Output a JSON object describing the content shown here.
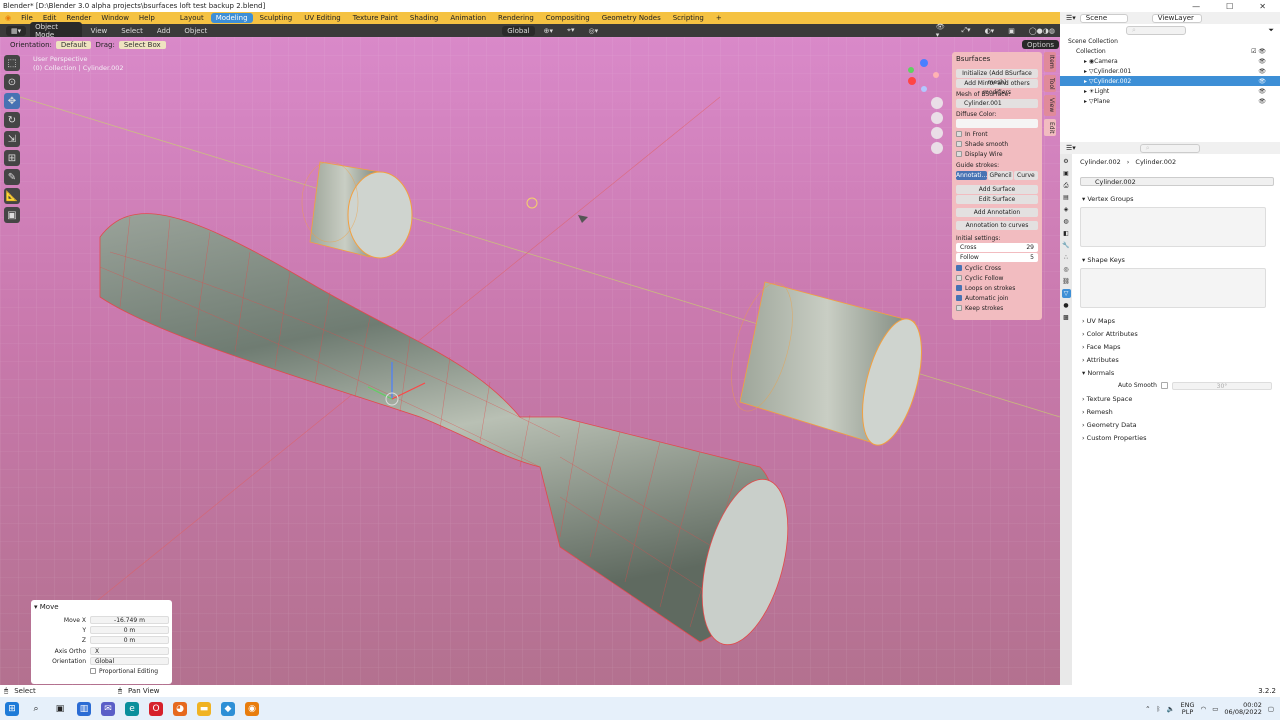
{
  "window": {
    "title": "Blender* [D:\\Blender 3.0 alpha projects\\bsurfaces loft test backup 2.blend]",
    "controls": [
      "—",
      "☐",
      "✕"
    ]
  },
  "menus": [
    "File",
    "Edit",
    "Render",
    "Window",
    "Help"
  ],
  "workspaces": [
    {
      "label": "Layout",
      "active": false
    },
    {
      "label": "Modeling",
      "active": true
    },
    {
      "label": "Sculpting",
      "active": false
    },
    {
      "label": "UV Editing",
      "active": false
    },
    {
      "label": "Texture Paint",
      "active": false
    },
    {
      "label": "Shading",
      "active": false
    },
    {
      "label": "Animation",
      "active": false
    },
    {
      "label": "Rendering",
      "active": false
    },
    {
      "label": "Compositing",
      "active": false
    },
    {
      "label": "Geometry Nodes",
      "active": false
    },
    {
      "label": "Scripting",
      "active": false
    }
  ],
  "scene": {
    "scene_name": "Scene",
    "view_layer": "ViewLayer"
  },
  "viewport_header": {
    "mode": "Object Mode",
    "menus": [
      "View",
      "Select",
      "Add",
      "Object"
    ],
    "transform_orientation": "Global",
    "options_label": "Options"
  },
  "tool_settings": {
    "orientation_label": "Orientation:",
    "orientation_value": "Default",
    "drag_label": "Drag:",
    "drag_value": "Select Box"
  },
  "viewport_overlay": {
    "line1": "User Perspective",
    "line2": "(0) Collection | Cylinder.002"
  },
  "npanel": {
    "title": "Bsurfaces",
    "init_button": "Initialize (Add BSurface mesh)",
    "mirror_button": "Add Mirror and others modifiers",
    "mesh_label": "Mesh of BSurface:",
    "mesh_value": "Cylinder.001",
    "diffuse_label": "Diffuse Color:",
    "in_front": "In Front",
    "shade_smooth": "Shade smooth",
    "display_wire": "Display Wire",
    "guide_label": "Guide strokes:",
    "guide_tabs": [
      "Annotati…",
      "GPencil",
      "Curve"
    ],
    "add_surface": "Add Surface",
    "edit_surface": "Edit Surface",
    "add_annotation": "Add Annotation",
    "annotation_to_curves": "Annotation to curves",
    "initial_label": "Initial settings:",
    "cross_label": "Cross",
    "cross_value": "29",
    "follow_label": "Follow",
    "follow_value": "5",
    "checks": [
      {
        "label": "Cyclic Cross",
        "on": true
      },
      {
        "label": "Cyclic Follow",
        "on": false
      },
      {
        "label": "Loops on strokes",
        "on": true
      },
      {
        "label": "Automatic join",
        "on": true
      },
      {
        "label": "Keep strokes",
        "on": false
      }
    ],
    "side_tabs": [
      "Item",
      "Tool",
      "View",
      "Edit"
    ]
  },
  "move_panel": {
    "title": "Move",
    "move_x_label": "Move X",
    "move_x": "-16.749 m",
    "y_label": "Y",
    "y": "0 m",
    "z_label": "Z",
    "z": "0 m",
    "axis_ortho_label": "Axis Ortho",
    "axis_ortho": "X",
    "orientation_label": "Orientation",
    "orientation": "Global",
    "proportional": "Proportional Editing"
  },
  "outliner": {
    "root": "Scene Collection",
    "collection": "Collection",
    "items": [
      {
        "name": "Camera",
        "selected": false
      },
      {
        "name": "Cylinder.001",
        "selected": false
      },
      {
        "name": "Cylinder.002",
        "selected": true
      },
      {
        "name": "Light",
        "selected": false
      },
      {
        "name": "Plane",
        "selected": false
      }
    ]
  },
  "properties": {
    "breadcrumb_object": "Cylinder.002",
    "breadcrumb_mesh": "Cylinder.002",
    "datablock": "Cylinder.002",
    "vertex_groups": "Vertex Groups",
    "shape_keys": "Shape Keys",
    "uv_maps": "UV Maps",
    "color_attributes": "Color Attributes",
    "face_maps": "Face Maps",
    "attributes": "Attributes",
    "normals": "Normals",
    "auto_smooth_label": "Auto Smooth",
    "auto_smooth_angle": "30°",
    "texture_space": "Texture Space",
    "remesh": "Remesh",
    "geometry_data": "Geometry Data",
    "custom_properties": "Custom Properties"
  },
  "statusbar": {
    "select": "Select",
    "pan_view": "Pan View",
    "version": "3.2.2"
  },
  "taskbar": {
    "lang": "ENG",
    "locale": "PLP",
    "time": "00:02",
    "date": "06/08/2022"
  },
  "colors": {
    "accent": "#3d8fd6",
    "topbar": "#f5c242",
    "npanel": "#f2bcc0",
    "wire": "#e24a4a"
  }
}
